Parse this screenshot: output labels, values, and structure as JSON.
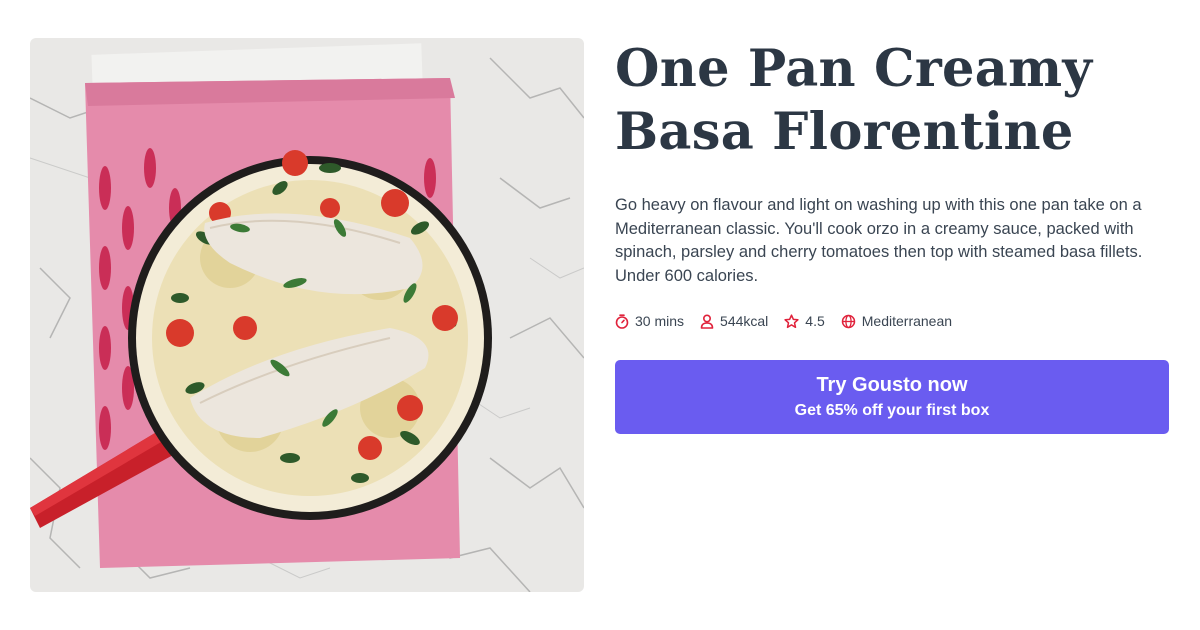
{
  "recipe": {
    "title": "One Pan Creamy Basa Florentine",
    "description": "Go heavy on flavour and light on washing up with this one pan take on a Mediterranean classic. You'll cook orzo in a creamy sauce, packed with spinach, parsley and cherry tomatoes then top with steamed basa fillets. Under 600 calories.",
    "meta": {
      "time": "30 mins",
      "calories": "544kcal",
      "rating": "4.5",
      "cuisine": "Mediterranean"
    },
    "icons": [
      "timer-icon",
      "person-icon",
      "star-icon",
      "globe-icon"
    ]
  },
  "cta": {
    "label": "Try Gousto now",
    "sublabel": "Get 65% off your first box"
  },
  "colors": {
    "accent": "#6a5cf0",
    "icon": "#e0223b",
    "text": "#2c3744"
  }
}
